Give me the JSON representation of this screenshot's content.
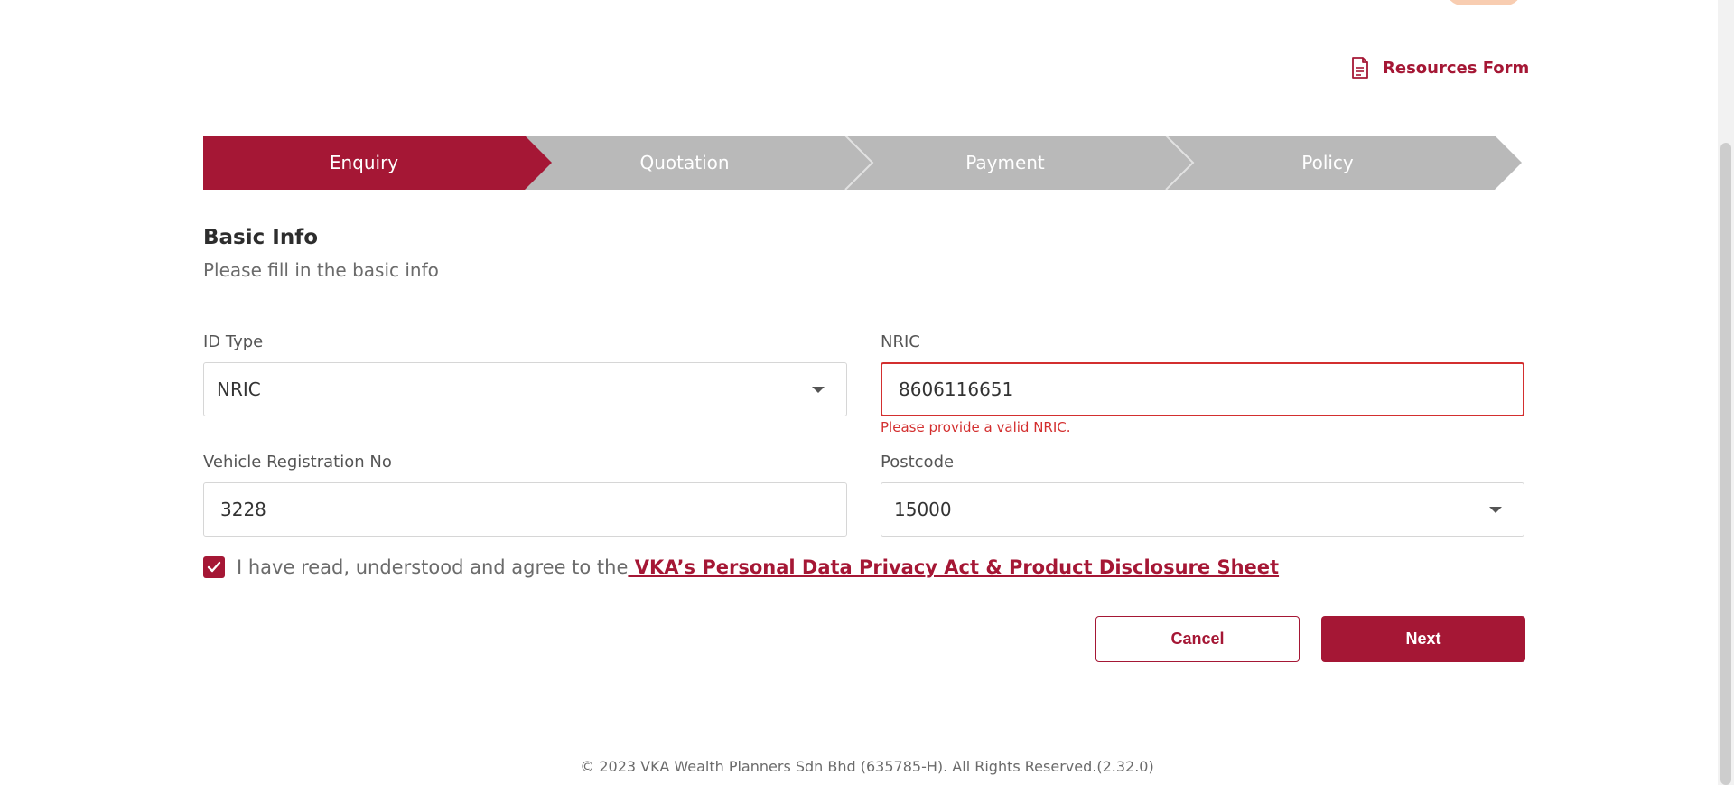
{
  "header": {
    "resources_label": "Resources Form"
  },
  "stepper": {
    "steps": [
      {
        "label": "Enquiry",
        "active": true
      },
      {
        "label": "Quotation",
        "active": false
      },
      {
        "label": "Payment",
        "active": false
      },
      {
        "label": "Policy",
        "active": false
      }
    ]
  },
  "form": {
    "title": "Basic Info",
    "subtitle": "Please fill in the basic info",
    "id_type": {
      "label": "ID Type",
      "value": "NRIC"
    },
    "nric": {
      "label": "NRIC",
      "value": "8606116651",
      "error": "Please provide a valid NRIC."
    },
    "vehicle": {
      "label": "Vehicle Registration No",
      "value": "3228"
    },
    "postcode": {
      "label": "Postcode",
      "value": "15000"
    },
    "agreement": {
      "checked": true,
      "text": "I have read, understood and agree to the",
      "link": " VKA’s Personal Data Privacy Act & Product Disclosure Sheet"
    }
  },
  "actions": {
    "cancel_label": "Cancel",
    "next_label": "Next"
  },
  "footer": {
    "text": "© 2023 VKA Wealth Planners Sdn Bhd (635785-H). All Rights Reserved.(2.32.0)"
  },
  "colors": {
    "brand": "#a51735",
    "step_inactive": "#b9b9b9",
    "error": "#d32f2f"
  },
  "icons": [
    "document-icon",
    "chevron-down-icon",
    "check-icon"
  ]
}
